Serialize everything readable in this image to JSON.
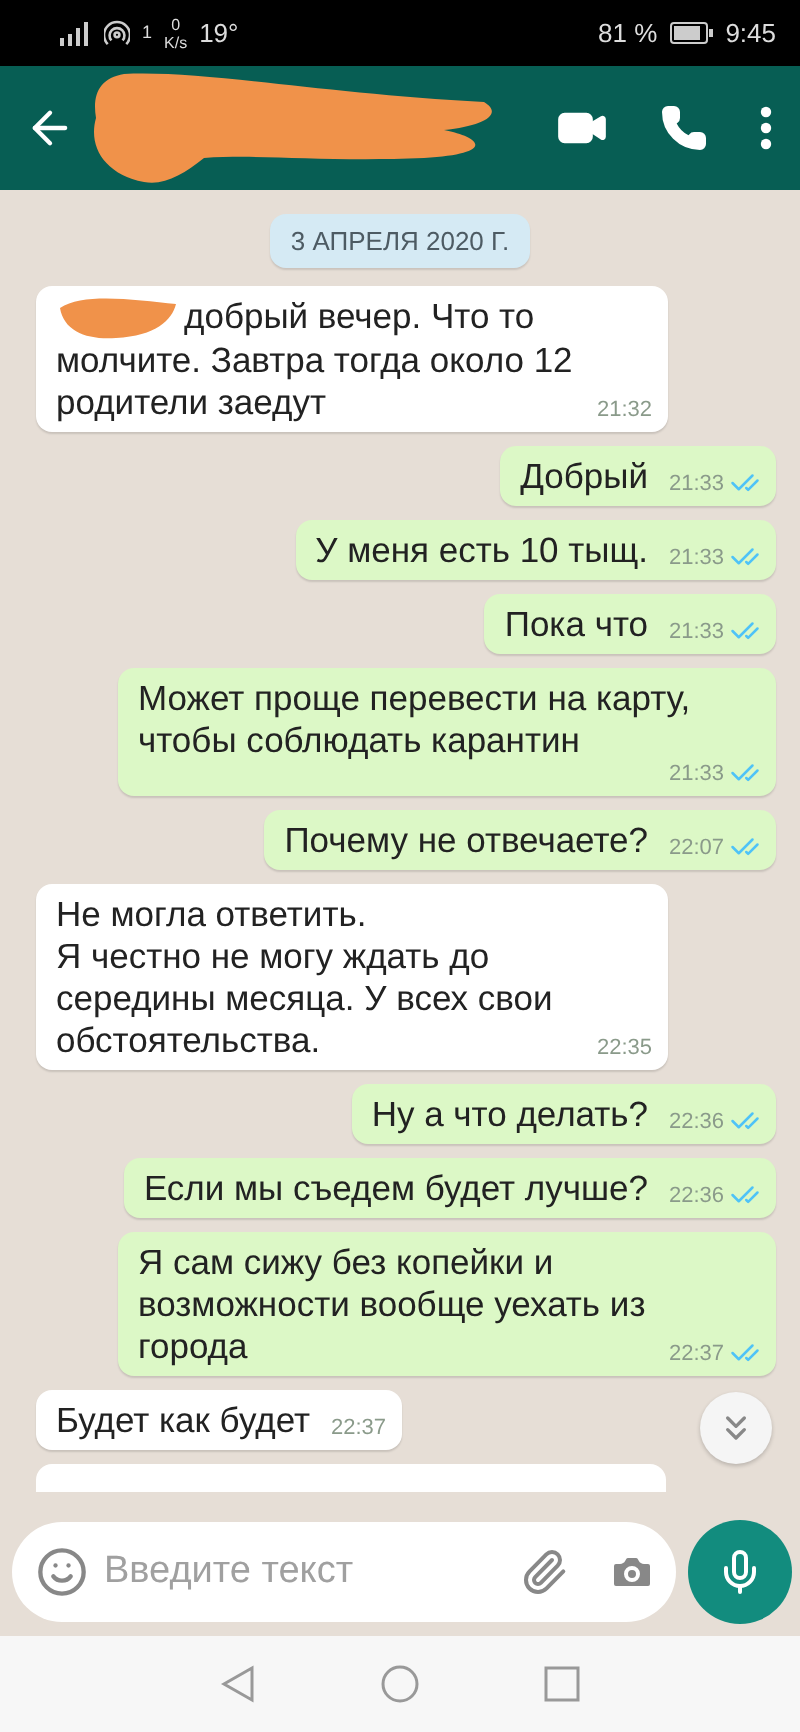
{
  "status_bar": {
    "network_badge": "1",
    "speed": "0",
    "speed_unit": "K/s",
    "temperature": "19°",
    "battery": "81 %",
    "time": "9:45"
  },
  "date_chip": "3 АПРЕЛЯ 2020 Г.",
  "messages": [
    {
      "kind": "in",
      "redacted": true,
      "text": "добрый вечер. Что то молчите. Завтра тогда около 12 родители заедут",
      "time": "21:32"
    },
    {
      "kind": "out",
      "text": "Добрый",
      "time": "21:33",
      "read": true
    },
    {
      "kind": "out",
      "text": "У меня есть 10 тыщ.",
      "time": "21:33",
      "read": true
    },
    {
      "kind": "out",
      "text": "Пока что",
      "time": "21:33",
      "read": true
    },
    {
      "kind": "out",
      "text": "Может проще перевести на карту, чтобы соблюдать карантин",
      "time": "21:33",
      "read": true
    },
    {
      "kind": "out",
      "text": "Почему не отвечаете?",
      "time": "22:07",
      "read": true
    },
    {
      "kind": "in",
      "redacted": false,
      "text": "Не могла ответить.\nЯ честно не могу ждать до середины месяца. У всех свои обстоятельства.",
      "time": "22:35"
    },
    {
      "kind": "out",
      "text": "Ну а что делать?",
      "time": "22:36",
      "read": true
    },
    {
      "kind": "out",
      "text": "Если мы съедем будет лучше?",
      "time": "22:36",
      "read": true
    },
    {
      "kind": "out",
      "text": "Я сам сижу без копейки и возможности вообще уехать из города",
      "time": "22:37",
      "read": true
    },
    {
      "kind": "in",
      "redacted": false,
      "text": "Будет как будет",
      "time": "22:37"
    },
    {
      "kind": "cut"
    }
  ],
  "composer": {
    "placeholder": "Введите текст"
  }
}
